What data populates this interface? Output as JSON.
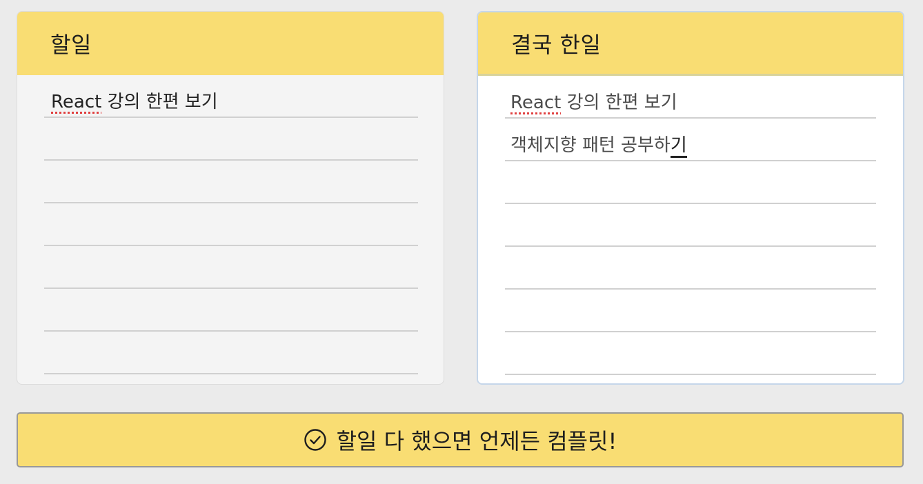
{
  "todo_panel": {
    "title": "할일",
    "items": [
      {
        "prefix": "React",
        "rest": " 강의 한편 보기"
      },
      {
        "prefix": "",
        "rest": ""
      },
      {
        "prefix": "",
        "rest": ""
      },
      {
        "prefix": "",
        "rest": ""
      },
      {
        "prefix": "",
        "rest": ""
      },
      {
        "prefix": "",
        "rest": ""
      },
      {
        "prefix": "",
        "rest": ""
      }
    ]
  },
  "done_panel": {
    "title": "결국 한일",
    "items": [
      {
        "prefix": "React",
        "rest": " 강의 한편 보기"
      },
      {
        "text": "객체지향 패턴 공부하",
        "caret_char": "기"
      },
      {
        "text": ""
      },
      {
        "text": ""
      },
      {
        "text": ""
      },
      {
        "text": ""
      },
      {
        "text": ""
      }
    ]
  },
  "complete_button": {
    "label": "할일 다 했으면 언제든 컴플릿!",
    "icon": "check-circle-icon"
  },
  "colors": {
    "background": "#ebebeb",
    "accent_yellow": "#f9dd73",
    "focus_border": "#c5d6ea",
    "spellcheck_underline": "#e04040"
  }
}
